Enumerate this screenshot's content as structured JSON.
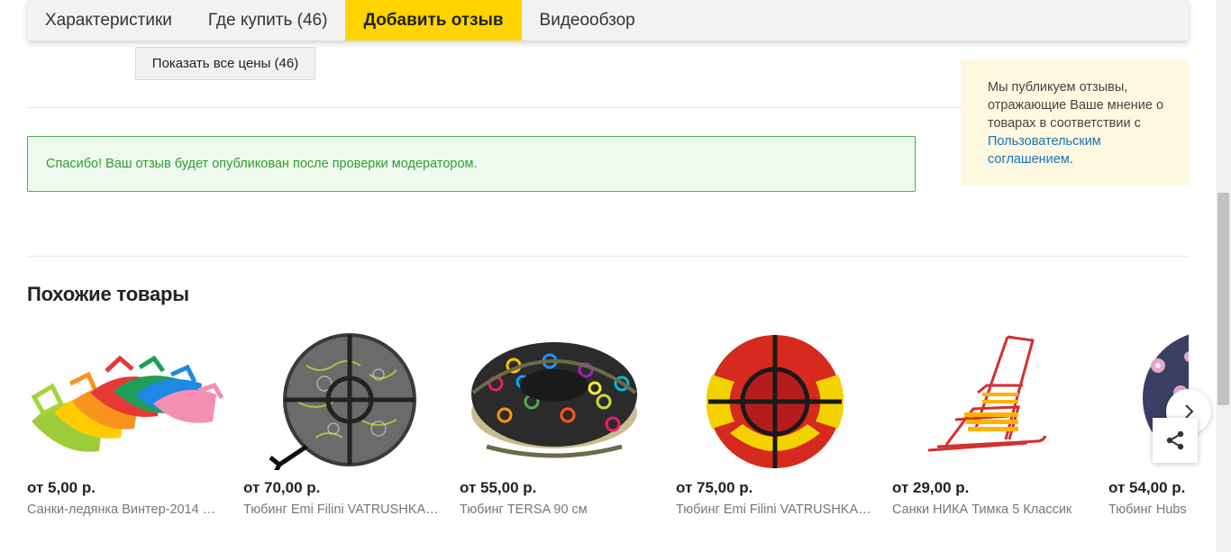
{
  "tabs": [
    {
      "label": "Характеристики"
    },
    {
      "label": "Где купить (46)"
    },
    {
      "label": "Добавить отзыв"
    },
    {
      "label": "Видеообзор"
    }
  ],
  "show_prices_label": "Показать все цены (46)",
  "success_message": "Спасибо! Ваш отзыв будет опубликован после проверки модератором.",
  "notice": {
    "text": "Мы публикуем отзывы, отражающие Ваше мнение о товарах в соответствии с",
    "link": "Пользовательским соглашением",
    "suffix": "."
  },
  "similar": {
    "title": "Похожие товары",
    "items": [
      {
        "price": "от 5,00 р.",
        "name": "Санки-ледянка Винтер-2014 …",
        "icon": "plastic-sled-image"
      },
      {
        "price": "от 70,00 р.",
        "name": "Тюбинг Emi Filini VATRUSHKA…",
        "icon": "snow-tube-image"
      },
      {
        "price": "от 55,00 р.",
        "name": "Тюбинг TERSA 90 см",
        "icon": "snow-tube-image"
      },
      {
        "price": "от 75,00 р.",
        "name": "Тюбинг Emi Filini VATRUSHKA…",
        "icon": "snow-tube-image"
      },
      {
        "price": "от 29,00 р.",
        "name": "Санки НИКА Тимка 5 Классик",
        "icon": "sled-image"
      },
      {
        "price": "от 54,00 р.",
        "name": "Тюбинг Hubs",
        "icon": "snow-tube-image"
      }
    ]
  },
  "colors": {
    "accent": "#ffd400",
    "success": "#4caf50",
    "link": "#1a73b8"
  }
}
